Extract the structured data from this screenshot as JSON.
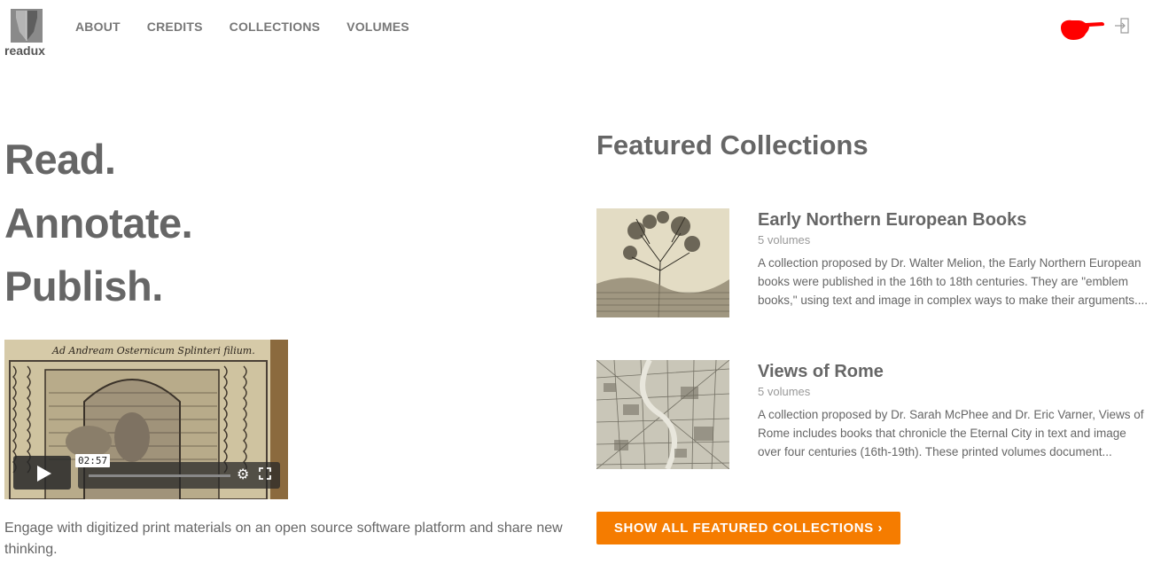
{
  "header": {
    "logo_text": "readux",
    "nav": [
      "ABOUT",
      "CREDITS",
      "COLLECTIONS",
      "VOLUMES"
    ],
    "icons": [
      "pointing-hand-icon",
      "sign-in-icon"
    ]
  },
  "hero": {
    "lines": [
      "Read.",
      "Annotate.",
      "Publish."
    ],
    "video_time": "02:57",
    "video_title": "Ad Andream Osternicum Splinteri filium.",
    "tagline": "Engage with digitized print materials on an open source software platform and share new thinking."
  },
  "featured": {
    "title": "Featured Collections",
    "collections": [
      {
        "title": "Early Northern European Books",
        "count": "5 volumes",
        "description": "A collection proposed by Dr. Walter Melion, the Early Northern European books were published in the 16th to 18th centuries. They are \"emblem books,\" using text and image in complex ways to make their arguments...."
      },
      {
        "title": "Views of Rome",
        "count": "5 volumes",
        "description": "A collection proposed by Dr. Sarah McPhee and Dr. Eric Varner, Views of Rome includes books that chronicle the Eternal City in text and image over four centuries (16th-19th). These printed volumes document..."
      }
    ],
    "show_all_label": "SHOW ALL FEATURED COLLECTIONS ›"
  },
  "colors": {
    "accent": "#f57c00",
    "text": "#666666",
    "hand": "#ff0000"
  }
}
